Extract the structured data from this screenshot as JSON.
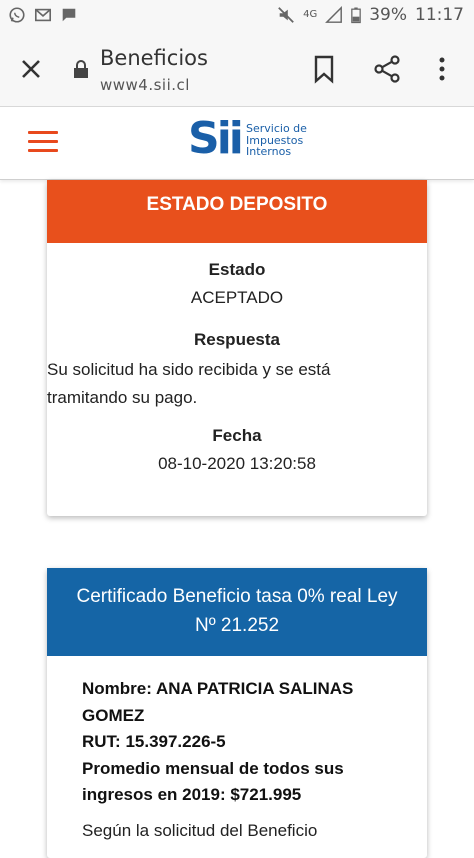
{
  "status_bar": {
    "battery": "39%",
    "time": "11:17",
    "network": "4G",
    "icons": [
      "whatsapp-icon",
      "gmail-icon",
      "message-icon",
      "mute-icon",
      "signal-icon",
      "battery-icon"
    ]
  },
  "browser": {
    "page_title": "Beneficios",
    "url": "www4.sii.cl",
    "icons": [
      "close-icon",
      "lock-icon",
      "bookmark-icon",
      "share-icon",
      "more-vert-icon"
    ]
  },
  "site_header": {
    "logo_mark": "Sii",
    "logo_text_lines": [
      "Servicio de",
      "Impuestos",
      "Internos"
    ]
  },
  "estado_card": {
    "header": "ESTADO DEPOSITO",
    "estado_label": "Estado",
    "estado_value": "ACEPTADO",
    "respuesta_label": "Respuesta",
    "respuesta_value": "Su solicitud ha sido recibida y se está tramitando su pago.",
    "fecha_label": "Fecha",
    "fecha_value": "08-10-2020 13:20:58"
  },
  "certificado_card": {
    "header_line1": "Certificado Beneficio tasa 0% real Ley",
    "header_line2": "Nº 21.252",
    "nombre": "Nombre: ANA PATRICIA SALINAS GOMEZ",
    "rut": "RUT: 15.397.226-5",
    "promedio": "Promedio mensual de todos sus ingresos en 2019: $721.995",
    "tail": "Según la solicitud del Beneficio"
  },
  "colors": {
    "orange": "#e8501c",
    "blue_header": "#1565a6",
    "sii_blue": "#1a5fa8"
  }
}
